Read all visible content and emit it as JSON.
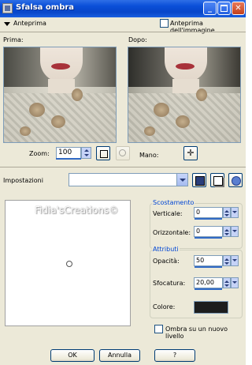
{
  "window": {
    "title": "Sfalsa ombra"
  },
  "preview": {
    "toggle_label": "Anteprima",
    "image_preview_label": "Anteprima dell'immagine",
    "image_preview_checked": false,
    "before_label": "Prima:",
    "after_label": "Dopo:"
  },
  "zoom": {
    "label": "Zoom:",
    "value": "100",
    "pan_label": "Mano:"
  },
  "settings": {
    "label": "Impostazioni",
    "value": ""
  },
  "canvas": {
    "watermark": "Fidia'sCreations©"
  },
  "offset": {
    "title": "Scostamento",
    "vertical_label": "Verticale:",
    "vertical_value": "0",
    "horizontal_label": "Orizzontale:",
    "horizontal_value": "0"
  },
  "attributes": {
    "title": "Attributi",
    "opacity_label": "Opacità:",
    "opacity_value": "50",
    "blur_label": "Sfocatura:",
    "blur_value": "20,00",
    "color_label": "Colore:",
    "color": "#1d1d1d"
  },
  "new_layer": {
    "label": "Ombra su un nuovo livello",
    "checked": false
  },
  "buttons": {
    "ok": "OK",
    "cancel": "Annulla",
    "help": "?"
  }
}
